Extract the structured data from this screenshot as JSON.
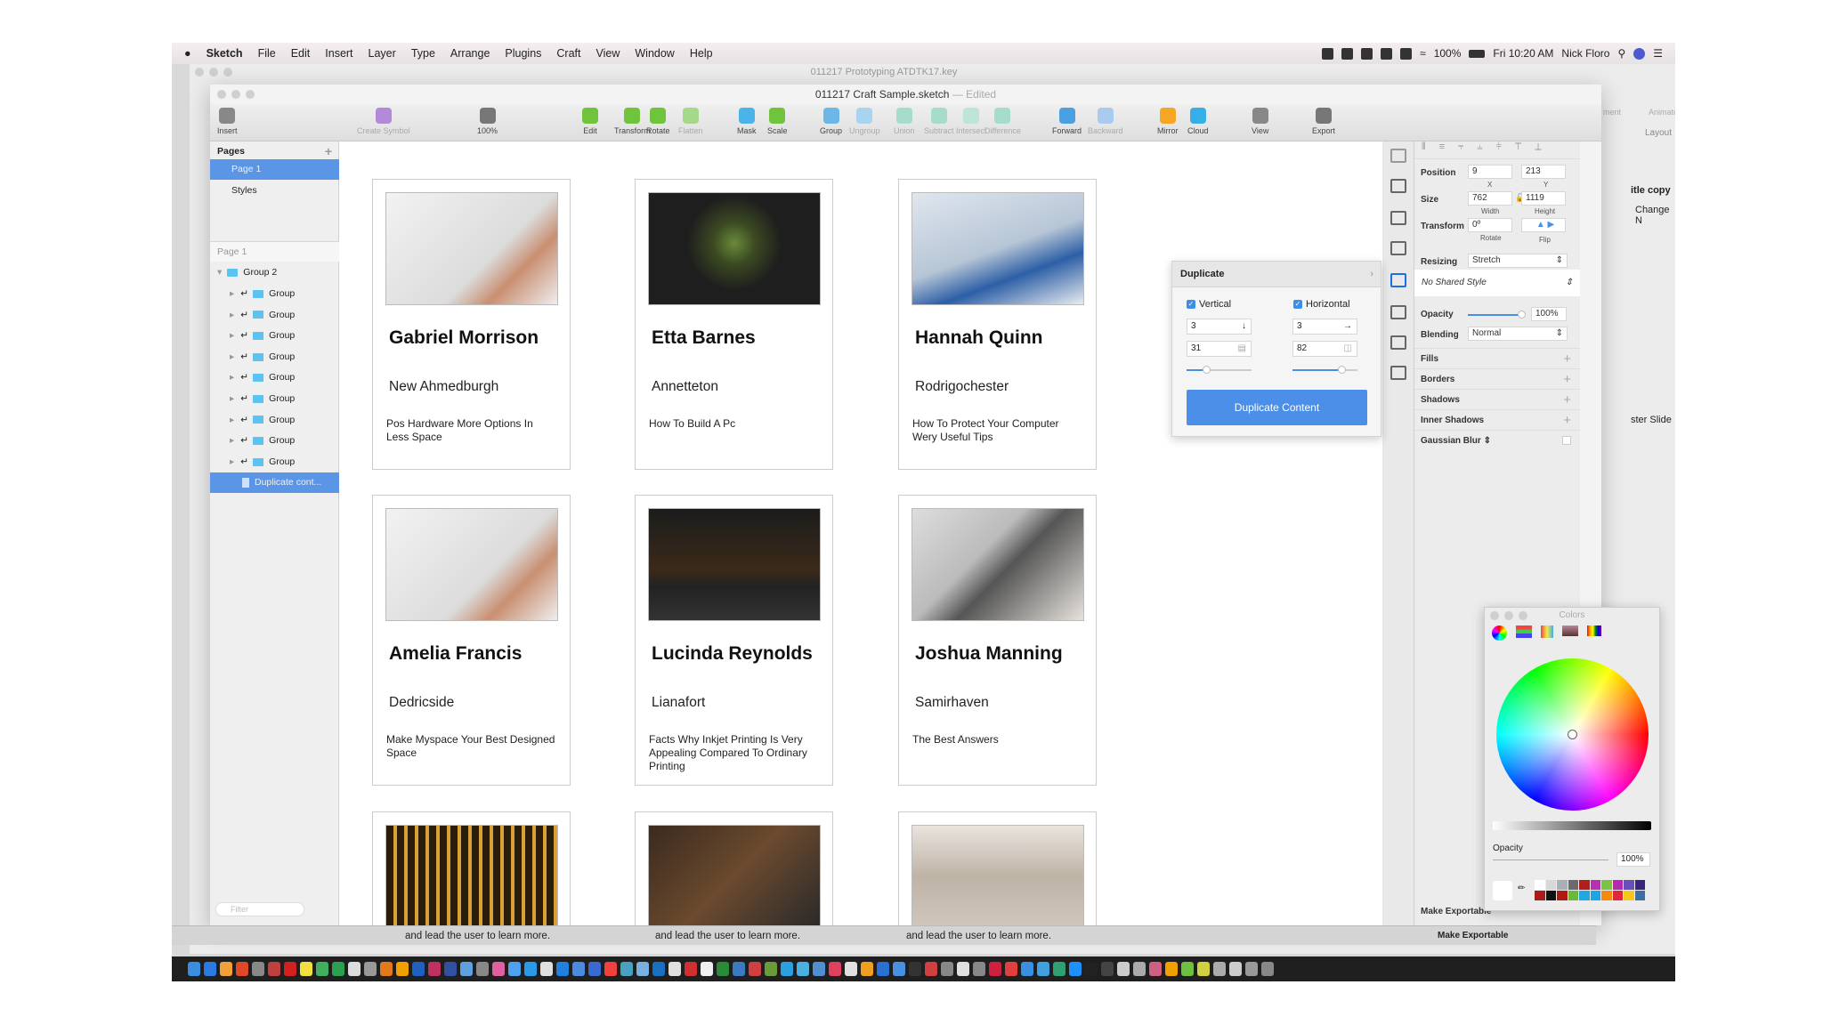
{
  "menubar": {
    "apple": "",
    "app": "Sketch",
    "items": [
      "File",
      "Edit",
      "Insert",
      "Layer",
      "Type",
      "Arrange",
      "Plugins",
      "Craft",
      "View",
      "Window",
      "Help"
    ],
    "battery": "100%",
    "clock": "Fri 10:20 AM",
    "user": "Nick Floro"
  },
  "background_window": {
    "title": "011217 Prototyping ATDTK17.key"
  },
  "window": {
    "title": "011217 Craft Sample.sketch",
    "edited": "— Edited"
  },
  "toolbar": [
    {
      "label": "Insert",
      "color": "#888"
    },
    {
      "label": "Create Symbol",
      "color": "#b38ad8"
    },
    {
      "label": "100%",
      "color": "#777"
    },
    {
      "label": "Edit",
      "color": "#6fc43c"
    },
    {
      "label": "Transform",
      "color": "#6fc43c"
    },
    {
      "label": "Rotate",
      "color": "#6fc43c"
    },
    {
      "label": "Flatten",
      "color": "#a6d88a"
    },
    {
      "label": "Mask",
      "color": "#4ab4e8"
    },
    {
      "label": "Scale",
      "color": "#6fc43c"
    },
    {
      "label": "Group",
      "color": "#6bb8e8"
    },
    {
      "label": "Ungroup",
      "color": "#a8d4ef"
    },
    {
      "label": "Union",
      "color": "#a6dccc"
    },
    {
      "label": "Subtract",
      "color": "#a6dccc"
    },
    {
      "label": "Intersect",
      "color": "#bde4d8"
    },
    {
      "label": "Difference",
      "color": "#a6dccc"
    },
    {
      "label": "Forward",
      "color": "#4aa0e0"
    },
    {
      "label": "Backward",
      "color": "#a8cbee"
    },
    {
      "label": "Mirror",
      "color": "#f5a623"
    },
    {
      "label": "Cloud",
      "color": "#38aee8"
    },
    {
      "label": "View",
      "color": "#888"
    },
    {
      "label": "Export",
      "color": "#777"
    }
  ],
  "pages": {
    "header": "Pages",
    "items": [
      "Page 1",
      "Styles"
    ],
    "layers_header": "Page 1",
    "group": "Group 2",
    "layers": [
      "Group",
      "Group",
      "Group",
      "Group",
      "Group",
      "Group",
      "Group",
      "Group",
      "Group"
    ],
    "selected_layer": "Duplicate cont...",
    "filter_placeholder": "Filter"
  },
  "cards": [
    {
      "name": "Gabriel Morrison",
      "city": "New Ahmedburgh",
      "desc": "Pos Hardware More Options In Less Space",
      "img": "linear-gradient(135deg,#f2f2f2,#dcdcdc 60%,#c98f72 75%,#eee)"
    },
    {
      "name": "Etta Barnes",
      "city": "Annetteton",
      "desc": "How To Build A Pc",
      "img": "radial-gradient(circle at 50% 45%,#6a8a3a 0,#3b4a22 20%,#1e1e1e 45%),linear-gradient(#222,#8a5a2a)"
    },
    {
      "name": "Hannah Quinn",
      "city": "Rodrigochester",
      "desc": "How To Protect Your Computer Wery Useful Tips",
      "img": "linear-gradient(160deg,#dfe6ee,#b7c6d6 50%,#2d5fa6 70%,#e8ecef)"
    },
    {
      "name": "Amelia Francis",
      "city": "Dedricside",
      "desc": "Make Myspace Your Best Designed Space",
      "img": "linear-gradient(135deg,#f2f2f2,#dcdcdc 60%,#c98f72 75%,#eee)"
    },
    {
      "name": "Lucinda Reynolds",
      "city": "Lianafort",
      "desc": "Facts Why Inkjet Printing Is Very Appealing Compared To Ordinary Printing",
      "img": "linear-gradient(#1c1c1c,#3a2a1a 55%,#222 70%,#333)"
    },
    {
      "name": "Joshua Manning",
      "city": "Samirhaven",
      "desc": "The Best Answers",
      "img": "linear-gradient(135deg,#ddd,#bbb 40%,#555 55%,#e6e2dc)"
    },
    {
      "name": "",
      "city": "",
      "desc": "",
      "img": "repeating-linear-gradient(90deg,#2a1d0c 0 8px,#d9a03a 8px 12px)"
    },
    {
      "name": "",
      "city": "",
      "desc": "",
      "img": "linear-gradient(135deg,#3b2a1e,#6b4a2e 50%,#2a2a2a)"
    },
    {
      "name": "",
      "city": "",
      "desc": "",
      "img": "linear-gradient(#e9e4de,#bfb3a6 50%,#cfc5bb)"
    }
  ],
  "bottom_strip": [
    "and lead the user to learn more.",
    "and lead the user to learn more.",
    "and lead the user to learn more."
  ],
  "duplicate": {
    "title": "Duplicate",
    "vertical_label": "Vertical",
    "horizontal_label": "Horizontal",
    "v_count": "3",
    "h_count": "3",
    "v_spacing": "31",
    "h_spacing": "82",
    "v_slider": 0.3,
    "h_slider": 0.75,
    "button": "Duplicate Content"
  },
  "inspector": {
    "position_label": "Position",
    "x": "9",
    "y": "213",
    "x_label": "X",
    "y_label": "Y",
    "size_label": "Size",
    "width": "762",
    "height": "1119",
    "width_label": "Width",
    "height_label": "Height",
    "transform_label": "Transform",
    "rotate": "0º",
    "rotate_label": "Rotate",
    "flip_label": "Flip",
    "resizing_label": "Resizing",
    "resizing": "Stretch",
    "shared_style": "No Shared Style",
    "opacity_label": "Opacity",
    "opacity": "100%",
    "opacity_value": 1.0,
    "blending_label": "Blending",
    "blending": "Normal",
    "sections": [
      "Fills",
      "Borders",
      "Shadows",
      "Inner Shadows"
    ],
    "blur": "Gaussian Blur",
    "make_exportable": "Make Exportable"
  },
  "right_partial": {
    "title_copy": "itle copy",
    "change": "Change N",
    "master": "ster Slide",
    "animate": "Animate",
    "layout": "Layout",
    "ment": "ment"
  },
  "colors_panel": {
    "title": "Colors",
    "opacity_label": "Opacity",
    "opacity": "100%",
    "swatches": [
      "#ffffff",
      "#d8d8d8",
      "#a9afb8",
      "#6b6b6b",
      "#b21d1d",
      "#b82fb0",
      "#7ec242",
      "#b62ab0",
      "#6b4fb8",
      "#3a2480",
      "#a81c1c",
      "#111111",
      "#b01a10",
      "#6ab83c",
      "#22a8e0",
      "#1fa4e6",
      "#f58b0c",
      "#e0283c",
      "#f6c81a",
      "#3a6fa8"
    ]
  },
  "dock_colors": [
    "#3b8de0",
    "#2a7be0",
    "#f2a03a",
    "#e0482a",
    "#888",
    "#c04040",
    "#d02020",
    "#f0e040",
    "#40b060",
    "#2aa050",
    "#ddd",
    "#999",
    "#e07a1a",
    "#f0a000",
    "#2060c0",
    "#c03060",
    "#3050a0",
    "#60a0e0",
    "#888",
    "#e060a0",
    "#50a0f0",
    "#2a9ae8",
    "#e0e0e0",
    "#2080e0",
    "#4a8ae0",
    "#3a6ad0",
    "#f04040",
    "#4aa0c0",
    "#7ab0e0",
    "#1a70c0",
    "#e0e0e0",
    "#d03030",
    "#f0f0f0",
    "#2a8a3a",
    "#3a7ac0",
    "#d04040",
    "#6a9a3a",
    "#2aa0e0",
    "#4ab0e0",
    "#5090d0",
    "#e04060",
    "#e0e0e0",
    "#f0a020",
    "#2a70d0",
    "#4a90e0",
    "#333",
    "#d04040",
    "#888",
    "#e0e0e0",
    "#888",
    "#d02040",
    "#e04040",
    "#3a90e0",
    "#40a0e0",
    "#30a070",
    "#1e90ff",
    "#222",
    "#444",
    "#ccc",
    "#aaa",
    "#d06080",
    "#f0a000",
    "#70c040",
    "#d0d040",
    "#aaa",
    "#ccc",
    "#999",
    "#888"
  ]
}
